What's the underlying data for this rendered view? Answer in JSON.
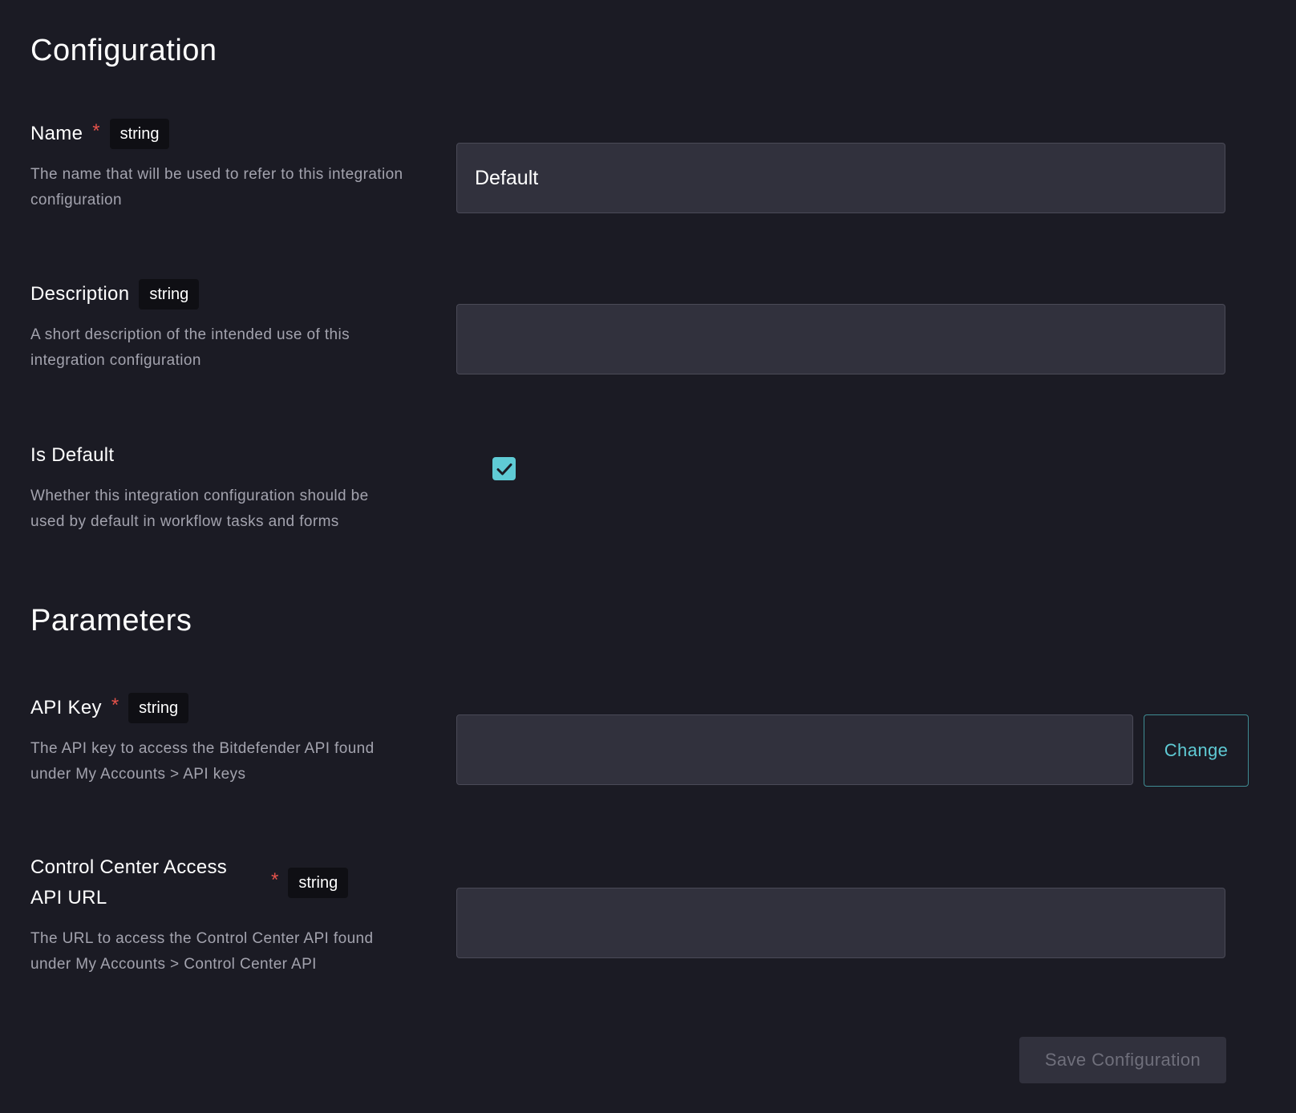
{
  "configuration": {
    "title": "Configuration",
    "fields": {
      "name": {
        "label": "Name",
        "required_mark": "*",
        "type": "string",
        "help": "The name that will be used to refer to this integration configuration",
        "value": "Default"
      },
      "description": {
        "label": "Description",
        "type": "string",
        "help": "A short description of the intended use of this integration configuration",
        "value": ""
      },
      "is_default": {
        "label": "Is Default",
        "help": "Whether this integration configuration should be used by default in workflow tasks and forms",
        "checked": true,
        "icon": "check-icon"
      }
    }
  },
  "parameters": {
    "title": "Parameters",
    "fields": {
      "api_key": {
        "label": "API Key",
        "required_mark": "*",
        "type": "string",
        "help": "The API key to access the Bitdefender API found under My Accounts > API keys",
        "value": "",
        "change_label": "Change"
      },
      "control_center_url": {
        "label": "Control Center Access API URL",
        "required_mark": "*",
        "type": "string",
        "help": "The URL to access the Control Center API found under My Accounts > Control Center API",
        "value": ""
      }
    }
  },
  "actions": {
    "save_label": "Save Configuration"
  },
  "colors": {
    "background": "#1b1b24",
    "input_background": "#31313d",
    "accent": "#5fcbd5",
    "required": "#e5534b",
    "badge_background": "#0f0f14"
  }
}
